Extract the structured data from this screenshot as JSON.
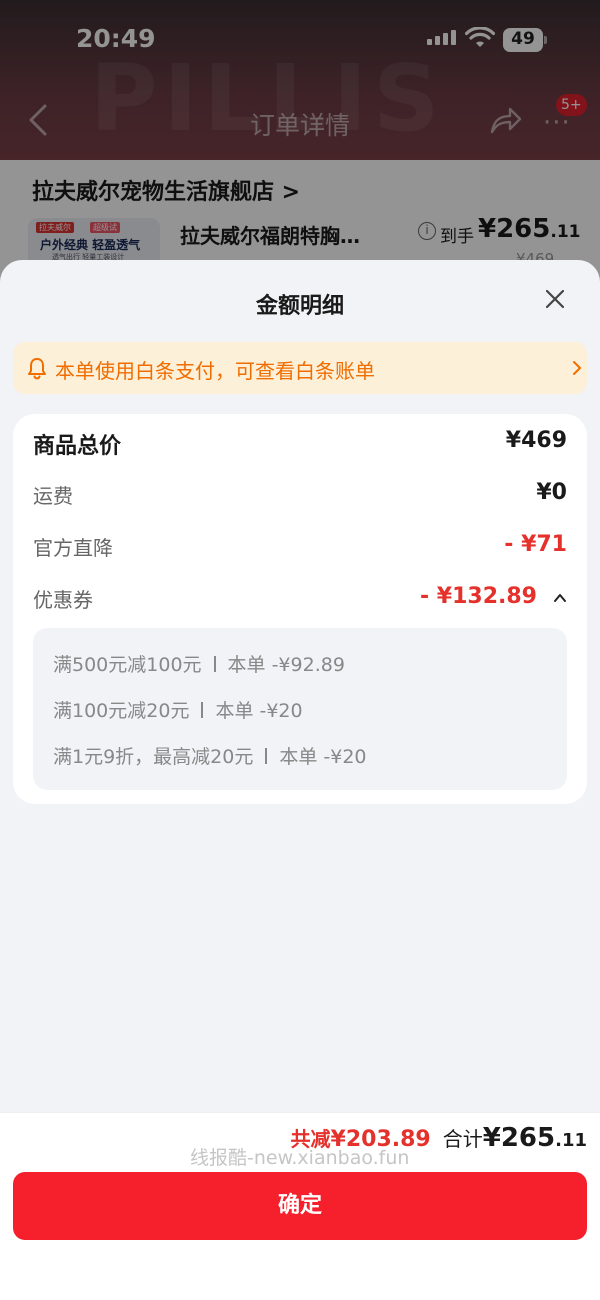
{
  "status_bar": {
    "time": "20:49",
    "battery": "49"
  },
  "background_page": {
    "title": "订单详情",
    "badge": "5+",
    "brand_logo": "PILLIS",
    "store_name": "拉夫威尔宠物生活旗舰店 >",
    "thumb_tag_1": "拉夫威尔",
    "thumb_tag_2": "超级试",
    "thumb_caption": "户外经典 轻盈透气",
    "thumb_subcaption": "透气出行 轻量工装设计",
    "product_name": "拉夫威尔福朗特胸…",
    "price_label": "到手",
    "price_int": "¥265",
    "price_dec": ".11",
    "old_price": "¥469"
  },
  "sheet": {
    "title": "金额明细",
    "notice": "本单使用白条支付，可查看白条账单",
    "rows": [
      {
        "label": "商品总价",
        "value": "¥469"
      },
      {
        "label": "运费",
        "value": "¥0"
      },
      {
        "label": "官方直降",
        "value": "- ¥71"
      },
      {
        "label": "优惠券",
        "value": "- ¥132.89"
      }
    ],
    "coupon_details": [
      {
        "rule": "满500元减100元",
        "amount": "本单 -¥92.89"
      },
      {
        "rule": "满100元减20元",
        "amount": "本单 -¥20"
      },
      {
        "rule": "满1元9折，最高减20元",
        "amount": "本单 -¥20"
      }
    ]
  },
  "footer": {
    "total_discount_label": "共减",
    "total_discount": "¥203.89",
    "total_label": "合计",
    "total_int": "¥265",
    "total_dec": ".11",
    "watermark": "线报酷-new.xianbao.fun",
    "confirm": "确定"
  },
  "colors": {
    "accent_red": "#e5312c",
    "button_red": "#f5202c",
    "notice_orange": "#f06d00",
    "notice_bg": "#fdf0d8"
  },
  "icons": [
    "back-arrow-icon",
    "share-icon",
    "more-icon",
    "info-icon",
    "close-icon",
    "bell-icon",
    "chevron-right-icon",
    "chevron-up-icon",
    "wifi-icon",
    "signal-icon",
    "battery-icon"
  ]
}
